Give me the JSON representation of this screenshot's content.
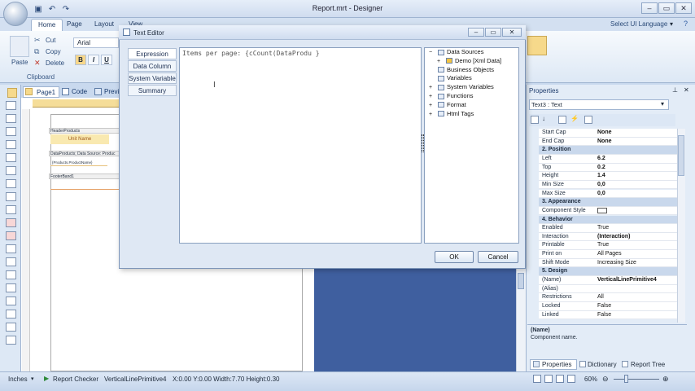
{
  "window": {
    "title": "Report.mrt - Designer"
  },
  "ribbon": {
    "tabs": [
      {
        "label": "Home"
      },
      {
        "label": "Page"
      },
      {
        "label": "Layout"
      },
      {
        "label": "View"
      }
    ],
    "select_language": "Select UI Language",
    "paste_label": "Paste",
    "cut_label": "Cut",
    "copy_label": "Copy",
    "delete_label": "Delete",
    "clipboard_group": "Clipboard",
    "font_name": "Arial"
  },
  "page_tabs": [
    {
      "label": "Page1"
    },
    {
      "label": "Code"
    },
    {
      "label": "Previ"
    }
  ],
  "report_bands": {
    "header_band": "HeaderProducts",
    "unit_name": "Unit Name",
    "data_band": "DataProducts; Data Source: Produc",
    "data_field": "{Products.ProductName}",
    "footer_band": "FooterBand1"
  },
  "dialog": {
    "title": "Text Editor",
    "side_tabs": [
      {
        "label": "Expression"
      },
      {
        "label": "Data Column"
      },
      {
        "label": "System Variable"
      },
      {
        "label": "Summary"
      }
    ],
    "editor_text": "Items per page: {cCount(DataProdu }",
    "tree": [
      {
        "label": "Data Sources",
        "indent": 0,
        "expander": "−"
      },
      {
        "label": "Demo [Xml Data]",
        "indent": 1,
        "expander": "+"
      },
      {
        "label": "Business Objects",
        "indent": 0,
        "expander": ""
      },
      {
        "label": "Variables",
        "indent": 0,
        "expander": ""
      },
      {
        "label": "System Variables",
        "indent": 0,
        "expander": "+"
      },
      {
        "label": "Functions",
        "indent": 0,
        "expander": "+"
      },
      {
        "label": "Format",
        "indent": 0,
        "expander": "+"
      },
      {
        "label": "Html Tags",
        "indent": 0,
        "expander": "+"
      }
    ],
    "ok_label": "OK",
    "cancel_label": "Cancel"
  },
  "properties": {
    "title": "Properties",
    "selected_object": "Text3 : Text",
    "rows": [
      {
        "key": "Start Cap",
        "value": "None",
        "cat": false
      },
      {
        "key": "End Cap",
        "value": "None",
        "cat": false
      },
      {
        "key": "2. Position",
        "value": "",
        "cat": true
      },
      {
        "key": "Left",
        "value": "6.2",
        "cat": false
      },
      {
        "key": "Top",
        "value": "0.2",
        "cat": false
      },
      {
        "key": "Height",
        "value": "1.4",
        "cat": false
      },
      {
        "key": "Min Size",
        "value": "0,0",
        "cat": false
      },
      {
        "key": "Max Size",
        "value": "0,0",
        "cat": false
      },
      {
        "key": "3. Appearance",
        "value": "",
        "cat": true
      },
      {
        "key": "Component Style",
        "value": "",
        "cat": false
      },
      {
        "key": "4. Behavior",
        "value": "",
        "cat": true
      },
      {
        "key": "Enabled",
        "value": "True",
        "cat": false
      },
      {
        "key": "Interaction",
        "value": "(Interaction)",
        "cat": false
      },
      {
        "key": "Printable",
        "value": "True",
        "cat": false
      },
      {
        "key": "Print on",
        "value": "All Pages",
        "cat": false
      },
      {
        "key": "Shift Mode",
        "value": "Increasing Size",
        "cat": false
      },
      {
        "key": "5. Design",
        "value": "",
        "cat": true
      },
      {
        "key": "(Name)",
        "value": "VerticalLinePrimitive4",
        "cat": false
      },
      {
        "key": "(Alias)",
        "value": "",
        "cat": false
      },
      {
        "key": "Restrictions",
        "value": "All",
        "cat": false
      },
      {
        "key": "Locked",
        "value": "False",
        "cat": false
      },
      {
        "key": "Linked",
        "value": "False",
        "cat": false
      }
    ],
    "desc_title": "(Name)",
    "desc_text": "Component name.",
    "bottom_tabs": [
      {
        "label": "Properties"
      },
      {
        "label": "Dictionary"
      },
      {
        "label": "Report Tree"
      }
    ]
  },
  "status": {
    "units": "Inches",
    "report_checker": "Report Checker",
    "component": "VerticalLinePrimitive4",
    "position": "X:0.00 Y:0.00 Width:7.70 Height:0.30",
    "zoom": "60%"
  }
}
